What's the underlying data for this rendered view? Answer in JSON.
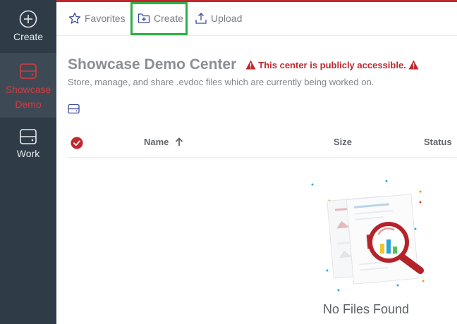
{
  "sidebar": {
    "items": [
      {
        "label": "Create",
        "icon": "plus-circle-icon"
      },
      {
        "label": "Showcase Demo",
        "icon": "drive-icon",
        "active": true
      },
      {
        "label": "Work",
        "icon": "drive-icon"
      }
    ]
  },
  "toolbar": {
    "favorites_label": "Favorites",
    "create_label": "Create",
    "upload_label": "Upload"
  },
  "header": {
    "title": "Showcase Demo Center",
    "warning": "This center is publicly accessible.",
    "subtitle": "Store, manage, and share .evdoc files which are currently being worked on."
  },
  "table": {
    "columns": {
      "name": "Name",
      "size": "Size",
      "status": "Status"
    },
    "sort": "name-ascending"
  },
  "empty": {
    "message": "No Files Found"
  },
  "colors": {
    "sidebar_bg": "#2f3c47",
    "accent_red": "#c0282d",
    "highlight_green": "#2db046"
  }
}
